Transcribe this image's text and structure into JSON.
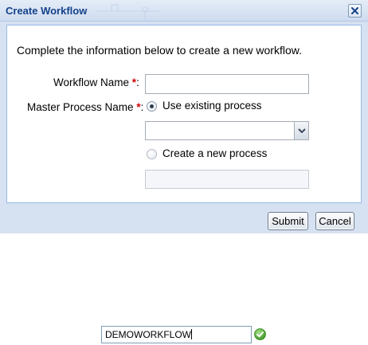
{
  "dialog": {
    "title": "Create Workflow",
    "intro": "Complete the information below to create a new workflow.",
    "workflow_name": {
      "label": "Workflow Name",
      "required_marker": "*",
      "suffix": ":",
      "value": ""
    },
    "master_process": {
      "label": "Master Process Name",
      "required_marker": "*",
      "suffix": ":",
      "options": {
        "use_existing": {
          "label": "Use existing process",
          "checked": true
        },
        "create_new": {
          "label": "Create a new process",
          "checked": false
        }
      },
      "existing_process_value": "",
      "new_process_value": ""
    },
    "buttons": {
      "submit": "Submit",
      "cancel": "Cancel"
    }
  },
  "floating_field": {
    "value": "DEMOWORKFLOW",
    "status_icon": "check-circle-icon",
    "status_color": "#5cb83a"
  },
  "colors": {
    "title_text": "#15428b",
    "dialog_bg": "#d6e1f1",
    "panel_border": "#99bbe8",
    "required": "#cc0000"
  }
}
